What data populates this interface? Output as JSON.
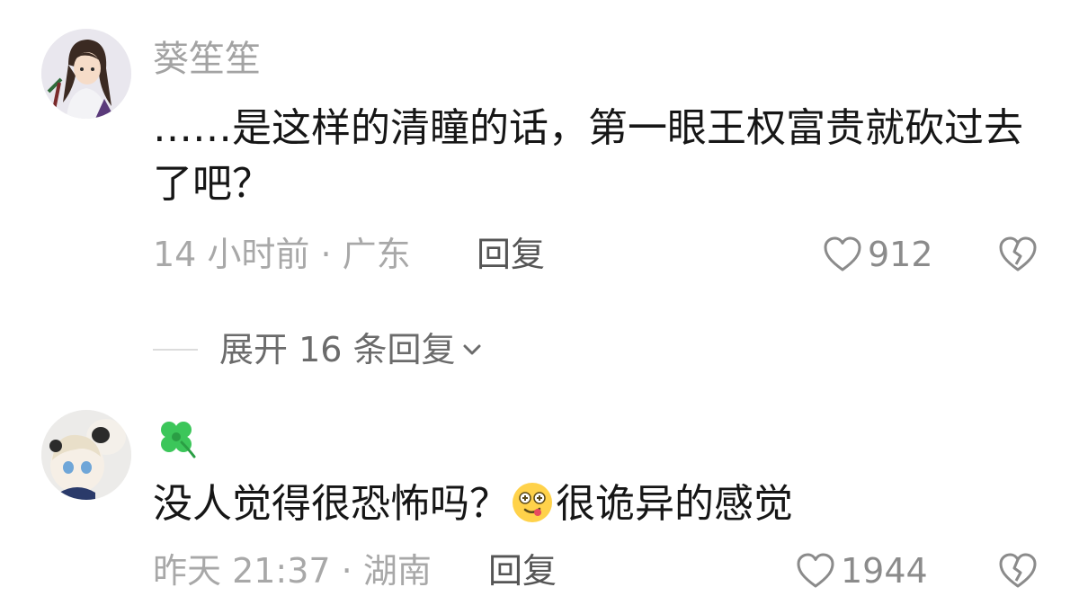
{
  "comments": [
    {
      "username": "葵笙笙",
      "text": "……是这样的清瞳的话，第一眼王权富贵就砍过去了吧？",
      "time_location": "14 小时前 · 广东",
      "reply_label": "回复",
      "likes": "912",
      "avatar_icon": "anime-girl-avatar",
      "like_icon": "heart-outline-icon",
      "dislike_icon": "broken-heart-icon"
    },
    {
      "username_icon": "four-leaf-clover-icon",
      "text_part1": "没人觉得很恐怖吗？",
      "inline_emoji": "dizzy-face-emoji",
      "text_part2": "很诡异的感觉",
      "time_location": "昨天 21:37 · 湖南",
      "reply_label": "回复",
      "likes": "1944",
      "avatar_icon": "plush-doll-avatar",
      "like_icon": "heart-outline-icon",
      "dislike_icon": "broken-heart-icon"
    }
  ],
  "expand_replies": {
    "label": "展开 16 条回复",
    "icon": "chevron-down-icon"
  },
  "colors": {
    "text_primary": "#161616",
    "text_secondary": "#a8a8a8",
    "accent_green": "#2fbf4a"
  }
}
